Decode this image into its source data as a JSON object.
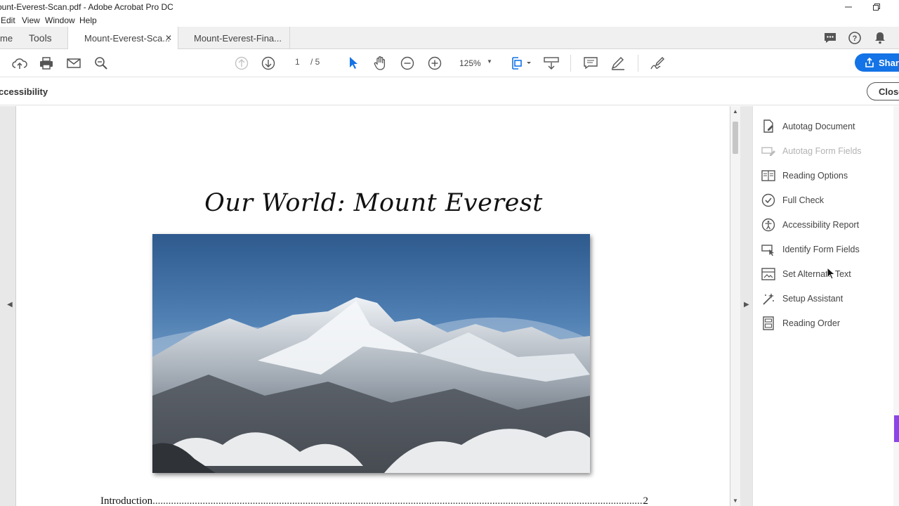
{
  "window": {
    "title": "ount-Everest-Scan.pdf - Adobe Acrobat Pro DC"
  },
  "menu": [
    "Edit",
    "View",
    "Window",
    "Help"
  ],
  "tabs": {
    "home": "me",
    "tools": "Tools",
    "doc1": "Mount-Everest-Sca...",
    "doc2": "Mount-Everest-Fina..."
  },
  "toolbar": {
    "page_current": "1",
    "page_total": "/ 5",
    "zoom": "125%",
    "share_label": "Shar"
  },
  "tool_pane": {
    "name": "ccessibility",
    "close_label": "Close"
  },
  "document": {
    "title": "Our World: Mount Everest",
    "toc_entry": "Introduction",
    "toc_page": "2"
  },
  "right_pane": {
    "items": [
      {
        "label": "Autotag Document",
        "icon": "autotag-document-icon",
        "enabled": true
      },
      {
        "label": "Autotag Form Fields",
        "icon": "autotag-form-fields-icon",
        "enabled": false
      },
      {
        "label": "Reading Options",
        "icon": "reading-options-icon",
        "enabled": true
      },
      {
        "label": "Full Check",
        "icon": "full-check-icon",
        "enabled": true
      },
      {
        "label": "Accessibility Report",
        "icon": "accessibility-report-icon",
        "enabled": true
      },
      {
        "label": "Identify Form Fields",
        "icon": "identify-form-fields-icon",
        "enabled": true
      },
      {
        "label": "Set Alternate Text",
        "icon": "set-alternate-text-icon",
        "enabled": true
      },
      {
        "label": "Setup Assistant",
        "icon": "setup-assistant-icon",
        "enabled": true
      },
      {
        "label": "Reading Order",
        "icon": "reading-order-icon",
        "enabled": true
      }
    ]
  },
  "colors": {
    "accent": "#1473e6",
    "purple_tab": "#8c46e6"
  }
}
